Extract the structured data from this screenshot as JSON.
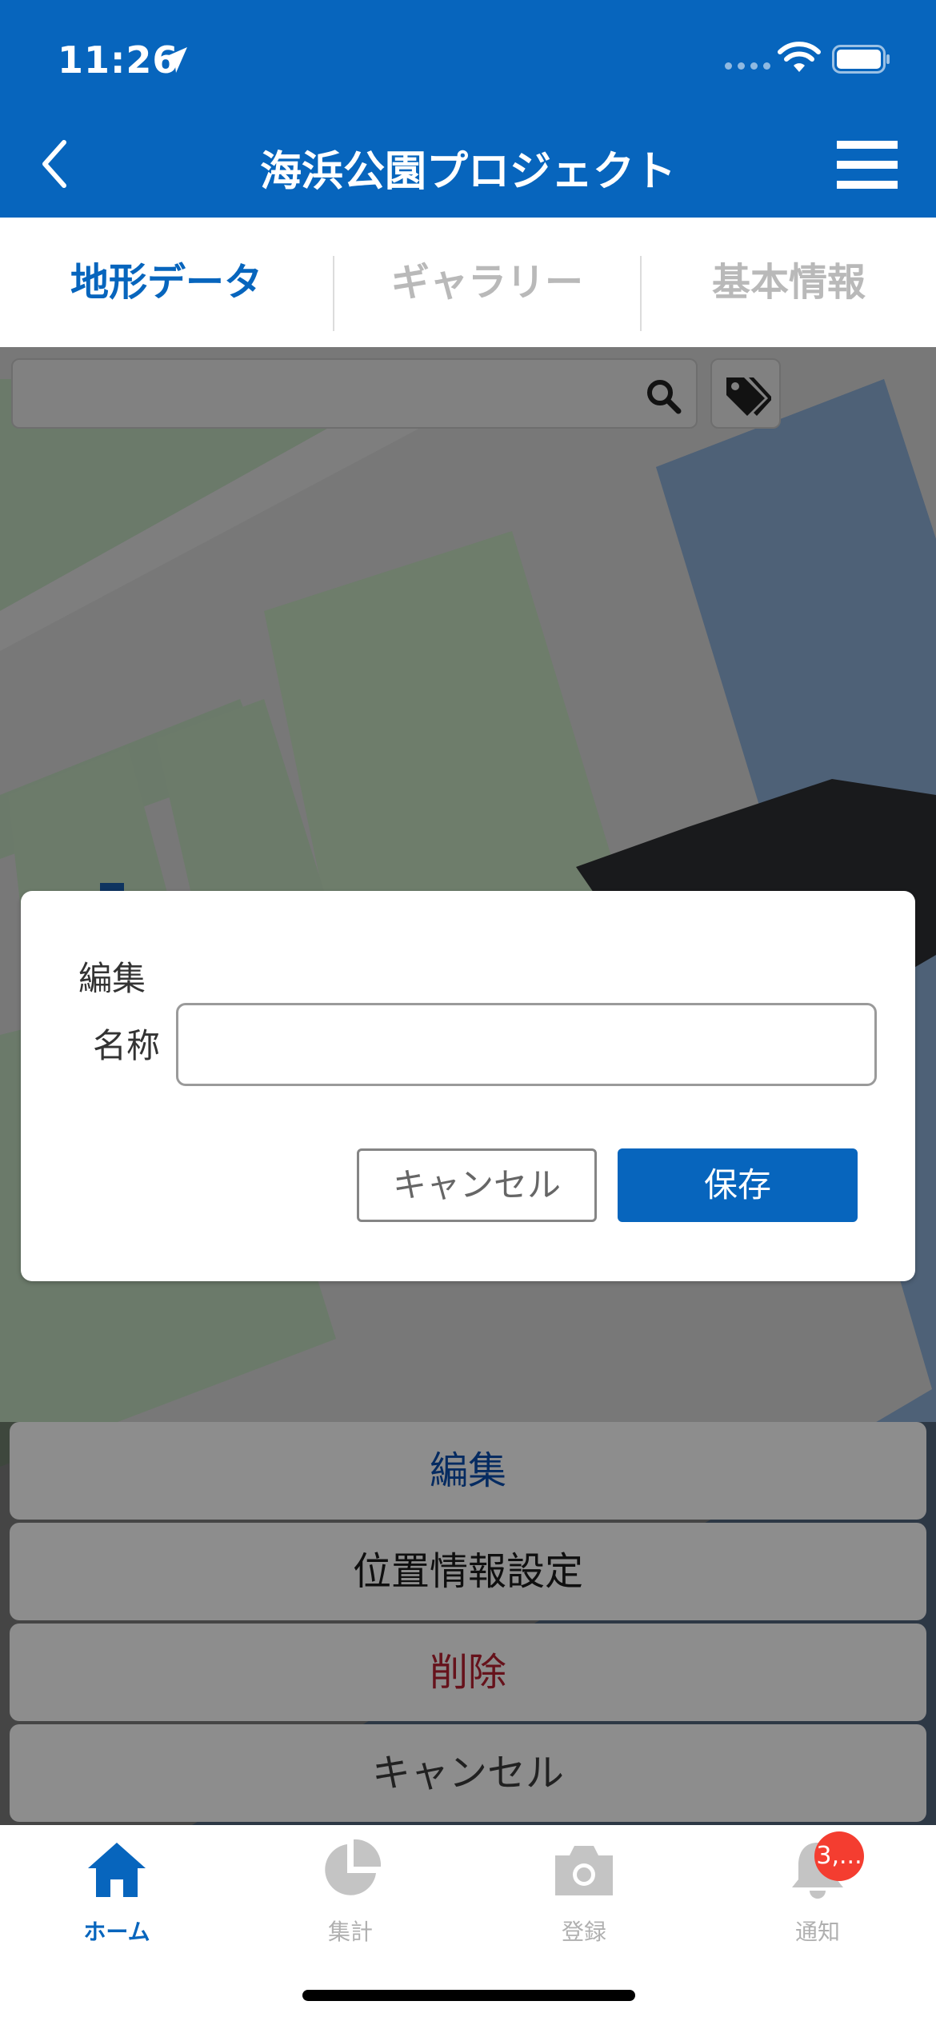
{
  "status_bar": {
    "time": "11:26",
    "icons": [
      "location-arrow-icon",
      "signal-icon",
      "wifi-icon",
      "battery-icon"
    ]
  },
  "header": {
    "title": "海浜公園プロジェクト",
    "back_icon": "chevron-left-icon",
    "menu_icon": "hamburger-menu-icon",
    "background": "#0765bd"
  },
  "tabs": [
    {
      "label": "地形データ",
      "active": true
    },
    {
      "label": "ギャラリー",
      "active": false
    },
    {
      "label": "基本情報",
      "active": false
    }
  ],
  "map_toolbar": {
    "search_value": "",
    "search_icon": "search-icon",
    "tag_icon": "tags-icon"
  },
  "dialog": {
    "title": "編集",
    "name_label": "名称",
    "name_value": "",
    "cancel_label": "キャンセル",
    "save_label": "保存"
  },
  "action_sheet": {
    "items": [
      {
        "label": "編集",
        "color": "#0a4aa8"
      },
      {
        "label": "位置情報設定",
        "color": "#1a1a1a"
      },
      {
        "label": "削除",
        "color": "#b01f2f"
      },
      {
        "label": "キャンセル",
        "color": "#3a3a3a"
      }
    ]
  },
  "bottom_nav": {
    "items": [
      {
        "label": "ホーム",
        "icon": "home-icon",
        "active": true
      },
      {
        "label": "集計",
        "icon": "pie-chart-icon",
        "active": false
      },
      {
        "label": "登録",
        "icon": "camera-icon",
        "active": false
      },
      {
        "label": "通知",
        "icon": "bell-icon",
        "active": false,
        "badge": "3,..."
      }
    ]
  },
  "colors": {
    "primary": "#0765bd",
    "inactive": "#b0b0b0",
    "badge": "#f43d30"
  }
}
